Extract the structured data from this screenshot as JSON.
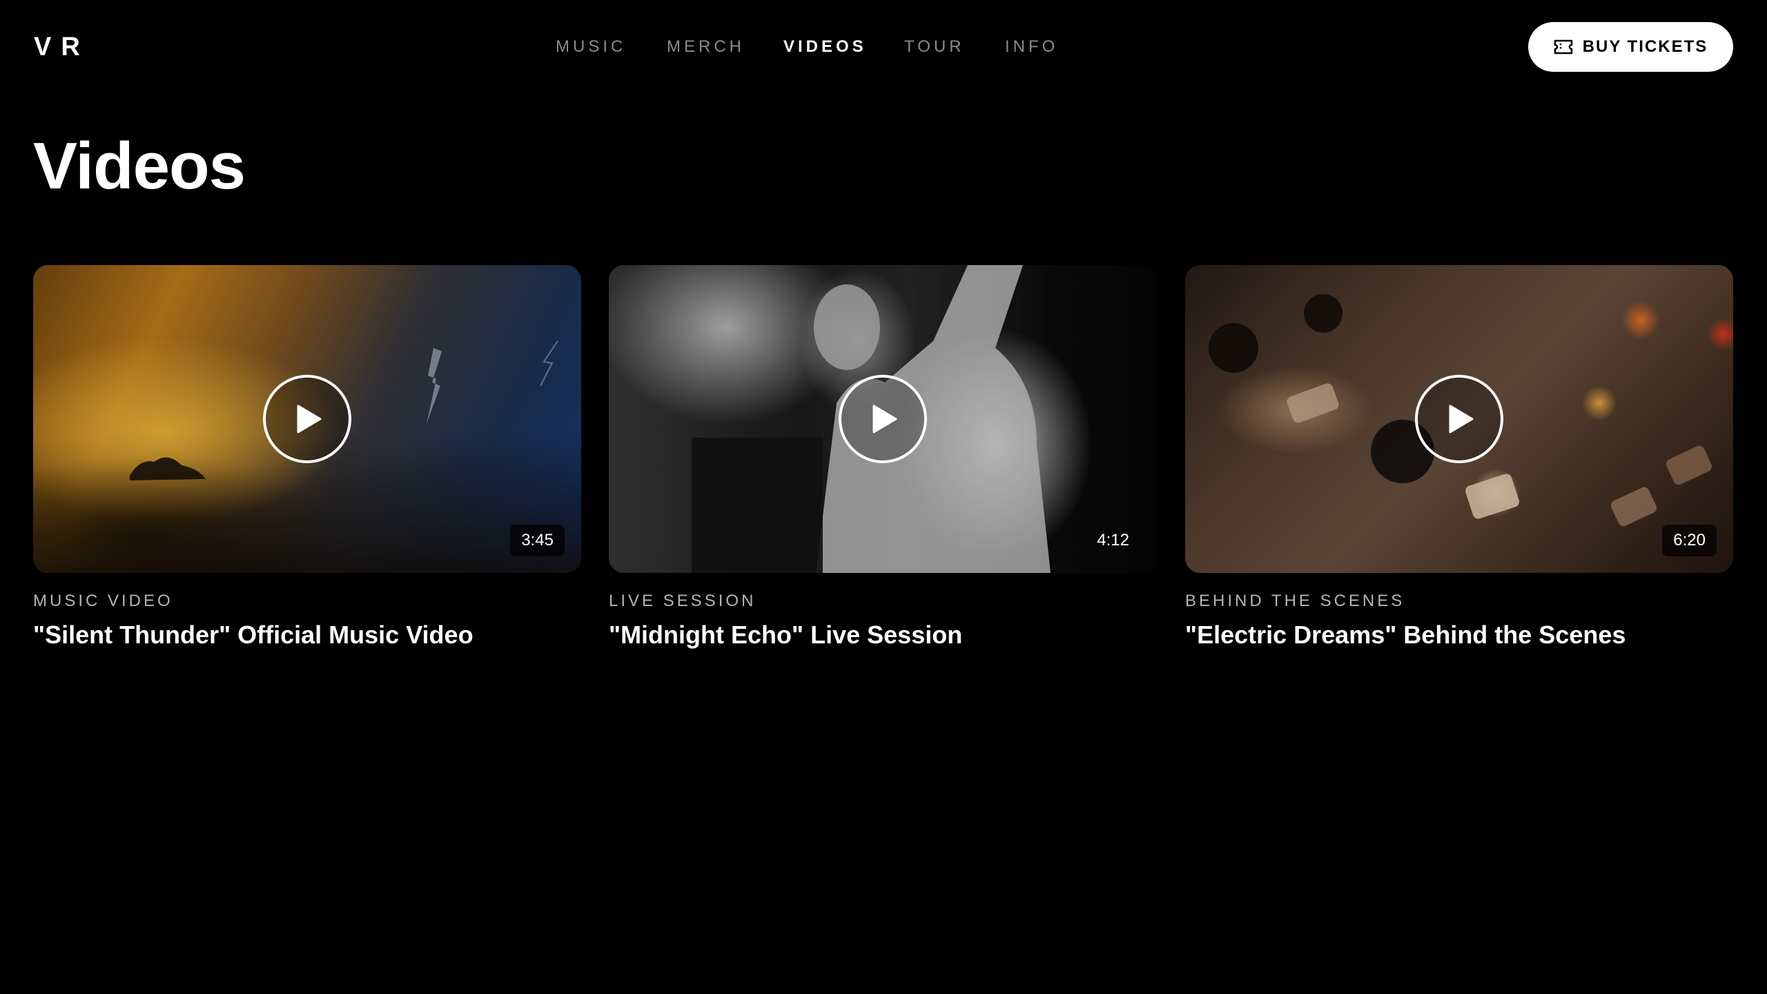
{
  "brand": {
    "logo": "VR"
  },
  "nav": {
    "items": [
      {
        "label": "MUSIC",
        "active": false
      },
      {
        "label": "MERCH",
        "active": false
      },
      {
        "label": "VIDEOS",
        "active": true
      },
      {
        "label": "TOUR",
        "active": false
      },
      {
        "label": "INFO",
        "active": false
      }
    ]
  },
  "header": {
    "cta_label": "BUY TICKETS",
    "cta_icon": "ticket-icon"
  },
  "page": {
    "title": "Videos"
  },
  "videos": [
    {
      "category": "MUSIC VIDEO",
      "title": "\"Silent Thunder\" Official Music Video",
      "duration": "3:45"
    },
    {
      "category": "LIVE SESSION",
      "title": "\"Midnight Echo\" Live Session",
      "duration": "4:12"
    },
    {
      "category": "BEHIND THE SCENES",
      "title": "\"Electric Dreams\" Behind the Scenes",
      "duration": "6:20"
    }
  ],
  "colors": {
    "background": "#000000",
    "text": "#ffffff",
    "muted": "#8a8a8a",
    "button_bg": "#ffffff"
  }
}
